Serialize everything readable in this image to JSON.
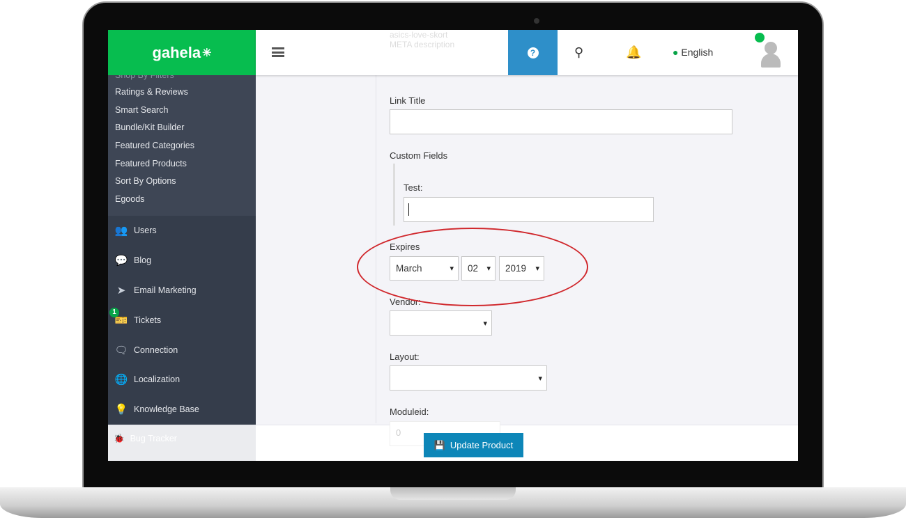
{
  "brand": {
    "logo": "gahela",
    "color": "#07bd4f"
  },
  "header": {
    "ghost_lines": [
      "asics-love-skort",
      "META description"
    ],
    "help_icon": "question-circle-icon",
    "search_icon": "search-icon",
    "bell_icon": "bell-icon",
    "language": "English",
    "avatar": "user-avatar-icon",
    "accent": "#2e8fc9"
  },
  "sidebar": {
    "sub_items": [
      "Shop By Filters",
      "Ratings & Reviews",
      "Smart Search",
      "Bundle/Kit Builder",
      "Featured Categories",
      "Featured Products",
      "Sort By Options",
      "Egoods"
    ],
    "items": [
      {
        "label": "Users",
        "icon": "users-icon"
      },
      {
        "label": "Blog",
        "icon": "comment-icon"
      },
      {
        "label": "Email Marketing",
        "icon": "paper-plane-icon"
      },
      {
        "label": "Tickets",
        "icon": "ticket-icon",
        "badge": "1"
      },
      {
        "label": "Connection",
        "icon": "comments-icon"
      },
      {
        "label": "Localization",
        "icon": "globe-icon"
      },
      {
        "label": "Knowledge Base",
        "icon": "lightbulb-icon"
      }
    ],
    "faded_item": "Bug Tracker"
  },
  "form": {
    "link_title": {
      "label": "Link Title",
      "value": ""
    },
    "custom_fields": {
      "label": "Custom Fields",
      "test_label": "Test:",
      "test_value": ""
    },
    "expires": {
      "label": "Expires",
      "month": "March",
      "day": "02",
      "year": "2019"
    },
    "vendor": {
      "label": "Vendor:",
      "value": ""
    },
    "layout": {
      "label": "Layout:",
      "value": ""
    },
    "moduleid": {
      "label": "Moduleid:",
      "value": "0"
    }
  },
  "actions": {
    "update_label": "Update Product",
    "button_color": "#0d86b8"
  },
  "annotation_color": "#d0272c"
}
